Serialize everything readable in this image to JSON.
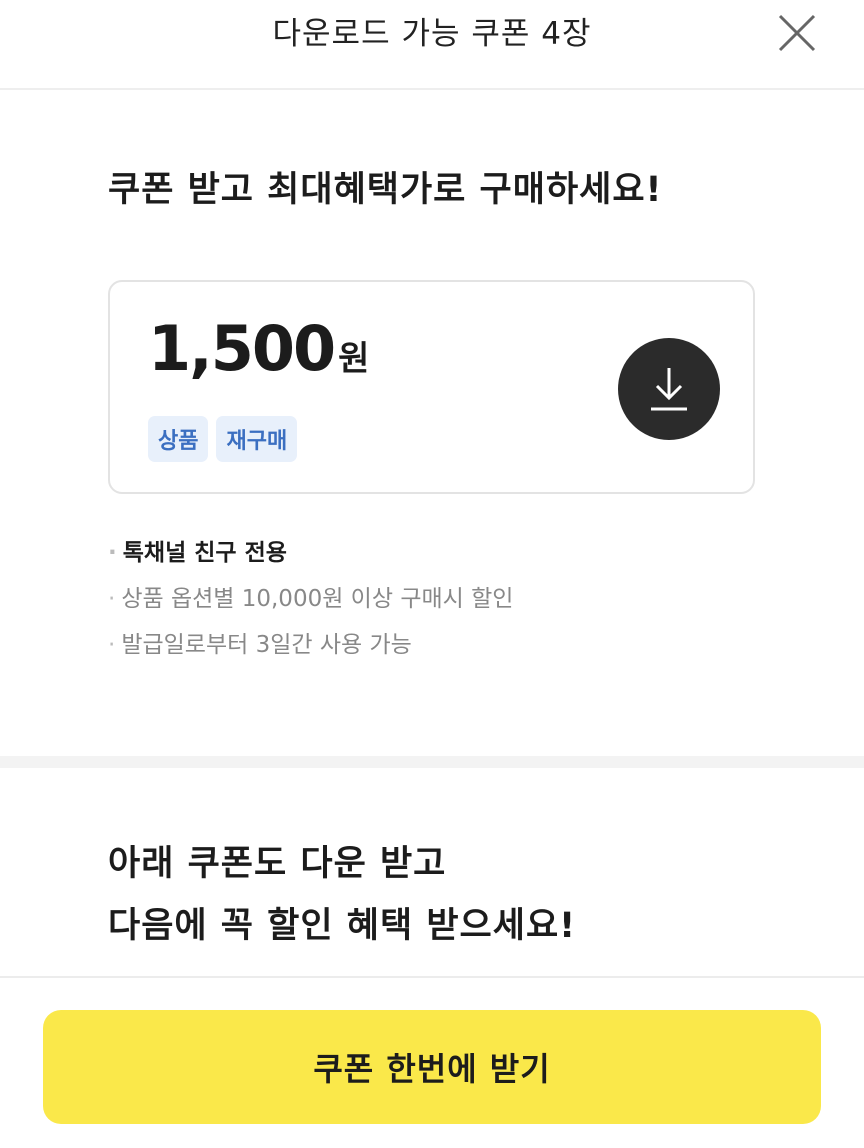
{
  "header": {
    "title": "다운로드 가능 쿠폰 4장",
    "close_icon": "close-icon"
  },
  "main_title": "쿠폰 받고 최대혜택가로 구매하세요!",
  "coupon": {
    "amount": "1,500",
    "unit": "원",
    "tags": [
      "상품",
      "재구매"
    ],
    "download_icon": "download-icon"
  },
  "notes": [
    "톡채널 친구 전용",
    "상품 옵션별 10,000원 이상 구매시 할인",
    "발급일로부터 3일간 사용 가능"
  ],
  "secondary_title": {
    "line1": "아래 쿠폰도 다운 받고",
    "line2": "다음에 꼭 할인 혜택 받으세요!"
  },
  "cta_label": "쿠폰 한번에 받기",
  "colors": {
    "cta_background": "#fae84a",
    "tag_background": "#e8f0fb",
    "tag_text": "#3b6fc1",
    "download_button": "#2b2b2b"
  }
}
